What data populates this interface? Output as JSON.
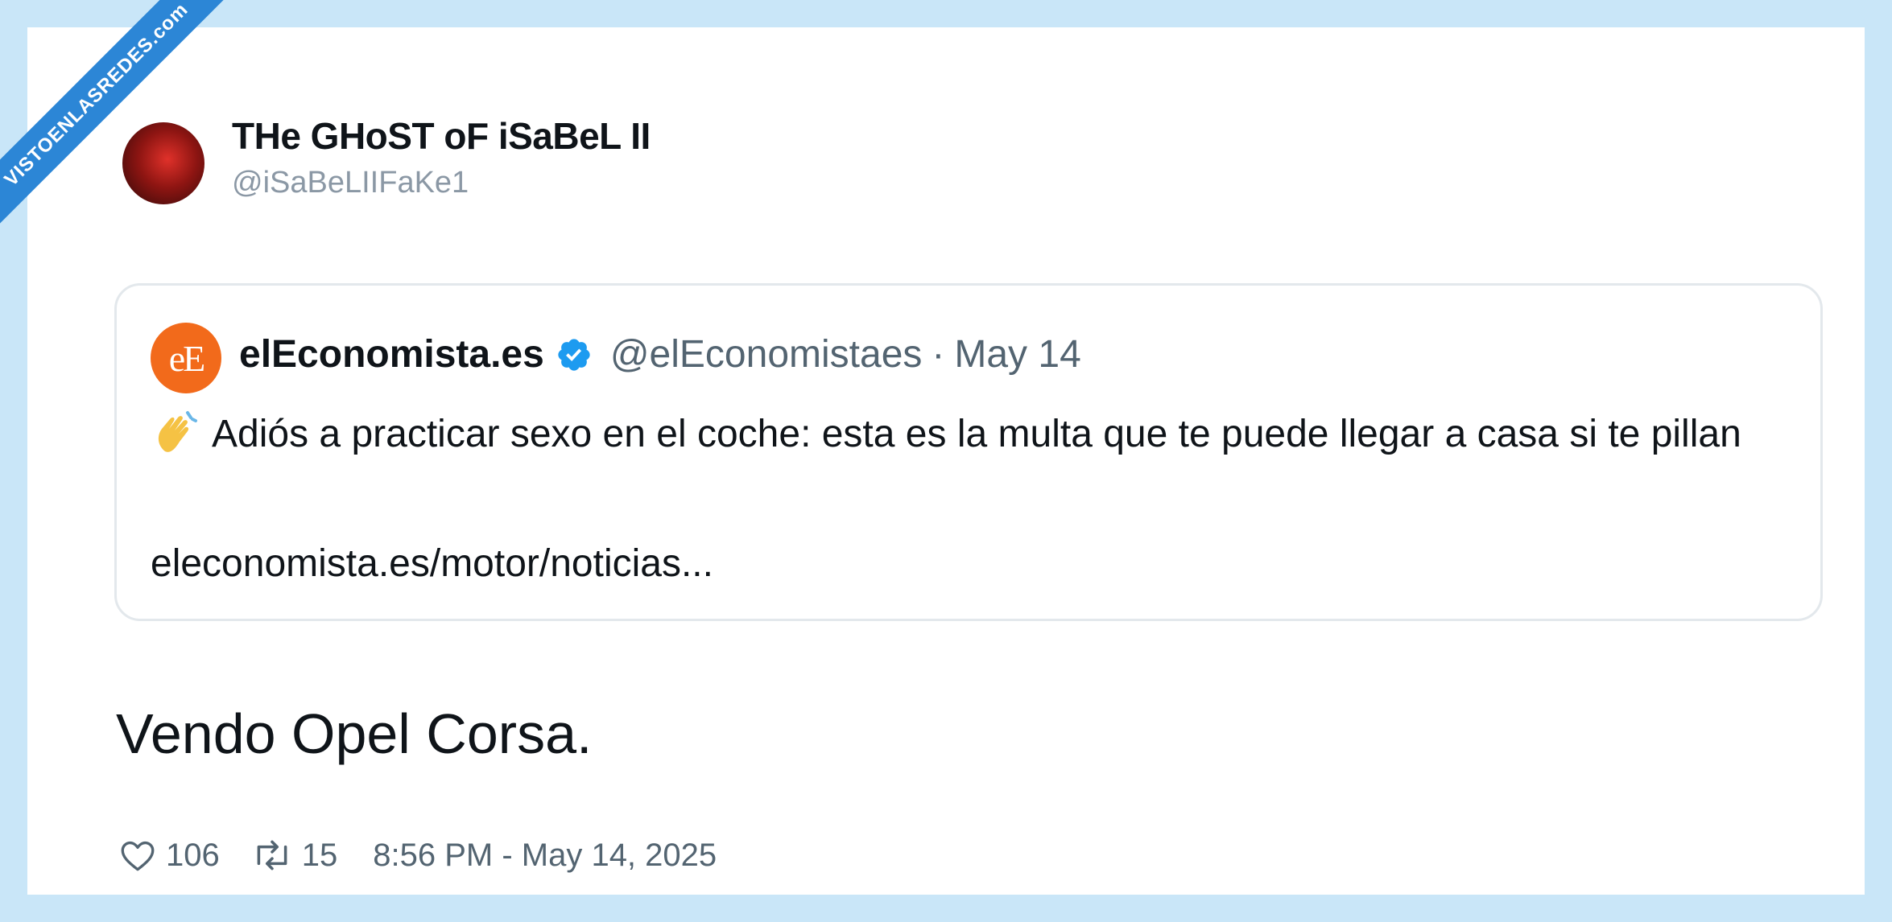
{
  "watermark": "VISTOENLASREDES.com",
  "tweet": {
    "author_name": "THe GHoST oF iSaBeL II",
    "author_handle": "@iSaBeLIIFaKe1",
    "text": "Vendo Opel Corsa.",
    "likes": "106",
    "retweets": "15",
    "timestamp": "8:56 PM - May 14, 2025"
  },
  "quoted": {
    "logo_text": "eE",
    "name": "elEconomista.es",
    "handle": "@elEconomistaes",
    "separator": "·",
    "date": "May 14",
    "text": "Adiós a practicar sexo en el coche: esta es la multa que te puede llegar a casa si te pillan",
    "link": "eleconomista.es/motor/noticias..."
  },
  "colors": {
    "background": "#c9e6f8",
    "verified": "#1d9bf0",
    "logo": "#f26a1b",
    "watermark": "#2c86d6"
  },
  "icons": [
    "avatar",
    "verified-badge-icon",
    "waving-hand-emoji",
    "heart-icon",
    "retweet-icon"
  ]
}
